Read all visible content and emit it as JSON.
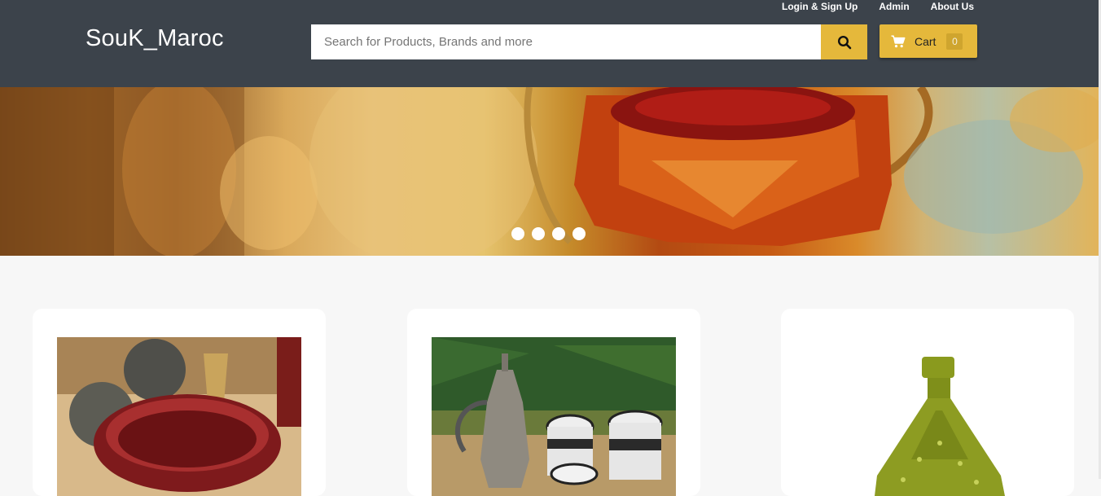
{
  "header": {
    "logo": "SouK_Maroc",
    "links": [
      "Login & Sign Up",
      "Admin",
      "About Us"
    ],
    "search": {
      "placeholder": "Search for Products, Brands and more",
      "value": ""
    },
    "search_icon": "search-icon",
    "cart": {
      "label": "Cart",
      "count": "0",
      "icon": "cart-icon"
    },
    "colors": {
      "bar": "#3c434b",
      "accent": "#e5b83b"
    }
  },
  "hero": {
    "image": "saffron in glass teapot",
    "dots": 4
  },
  "products": [
    {
      "image": "red ceramic bowl with ornaments"
    },
    {
      "image": "moroccan teapot with tea glasses"
    },
    {
      "image": "green ceramic tagine"
    }
  ]
}
